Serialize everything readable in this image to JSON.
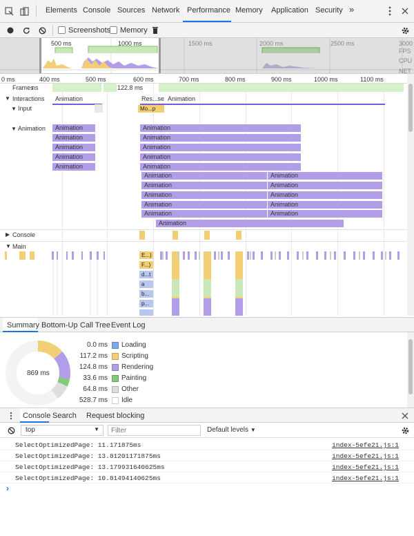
{
  "tabs": {
    "items": [
      "Elements",
      "Console",
      "Sources",
      "Network",
      "Performance",
      "Memory",
      "Application",
      "Security"
    ],
    "more": "»",
    "active": "Performance"
  },
  "toolbar": {
    "screenshots_label": "Screenshots",
    "memory_label": "Memory"
  },
  "overview": {
    "ticks": [
      "500 ms",
      "1000 ms",
      "1500 ms",
      "2000 ms",
      "2500 ms",
      "3000"
    ],
    "labels": [
      "FPS",
      "CPU",
      "NET"
    ]
  },
  "timeline": {
    "ticks": [
      "0 ms",
      "400 ms",
      "500 ms",
      "600 ms",
      "700 ms",
      "800 ms",
      "900 ms",
      "1000 ms",
      "1100 ms"
    ],
    "frames_label": "Frames",
    "frames_prefix": "ns",
    "frame_time": "122.8 ms",
    "interactions_label": "Interactions",
    "interactions_items": [
      "Animation",
      "Res...se",
      "Animation"
    ],
    "input_label": "Input",
    "input_event": "Mo...p",
    "animation_label": "Animation",
    "animation_bar": "Animation",
    "console_label": "Console",
    "main_label": "Main",
    "main_events": [
      "E...)",
      "F...)",
      "d...t",
      "a",
      "b...",
      "p..."
    ]
  },
  "bottom_tabs": [
    "Summary",
    "Bottom-Up",
    "Call Tree",
    "Event Log"
  ],
  "summary": {
    "total": "869 ms",
    "rows": [
      {
        "value": "0.0 ms",
        "label": "Loading",
        "color": "#7fa8f0"
      },
      {
        "value": "117.2 ms",
        "label": "Scripting",
        "color": "#f2ce74"
      },
      {
        "value": "124.8 ms",
        "label": "Rendering",
        "color": "#b29ee8"
      },
      {
        "value": "33.6 ms",
        "label": "Painting",
        "color": "#80c97f"
      },
      {
        "value": "64.8 ms",
        "label": "Other",
        "color": "#dedede"
      },
      {
        "value": "528.7 ms",
        "label": "Idle",
        "color": "#ffffff"
      }
    ]
  },
  "drawer": {
    "tabs": [
      "Console",
      "Search",
      "Request blocking"
    ],
    "active": "Console"
  },
  "console": {
    "context": "top",
    "filter_placeholder": "Filter",
    "levels": "Default levels",
    "messages": [
      {
        "text": "SelectOptimizedPage: 11.171875ms",
        "source": "index-5efe21.js:1"
      },
      {
        "text": "SelectOptimizedPage: 13.81201171875ms",
        "source": "index-5efe21.js:1"
      },
      {
        "text": "SelectOptimizedPage: 13.179931640625ms",
        "source": "index-5efe21.js:1"
      },
      {
        "text": "SelectOptimizedPage: 10.81494140625ms",
        "source": "index-5efe21.js:1"
      }
    ],
    "prompt": "›"
  }
}
